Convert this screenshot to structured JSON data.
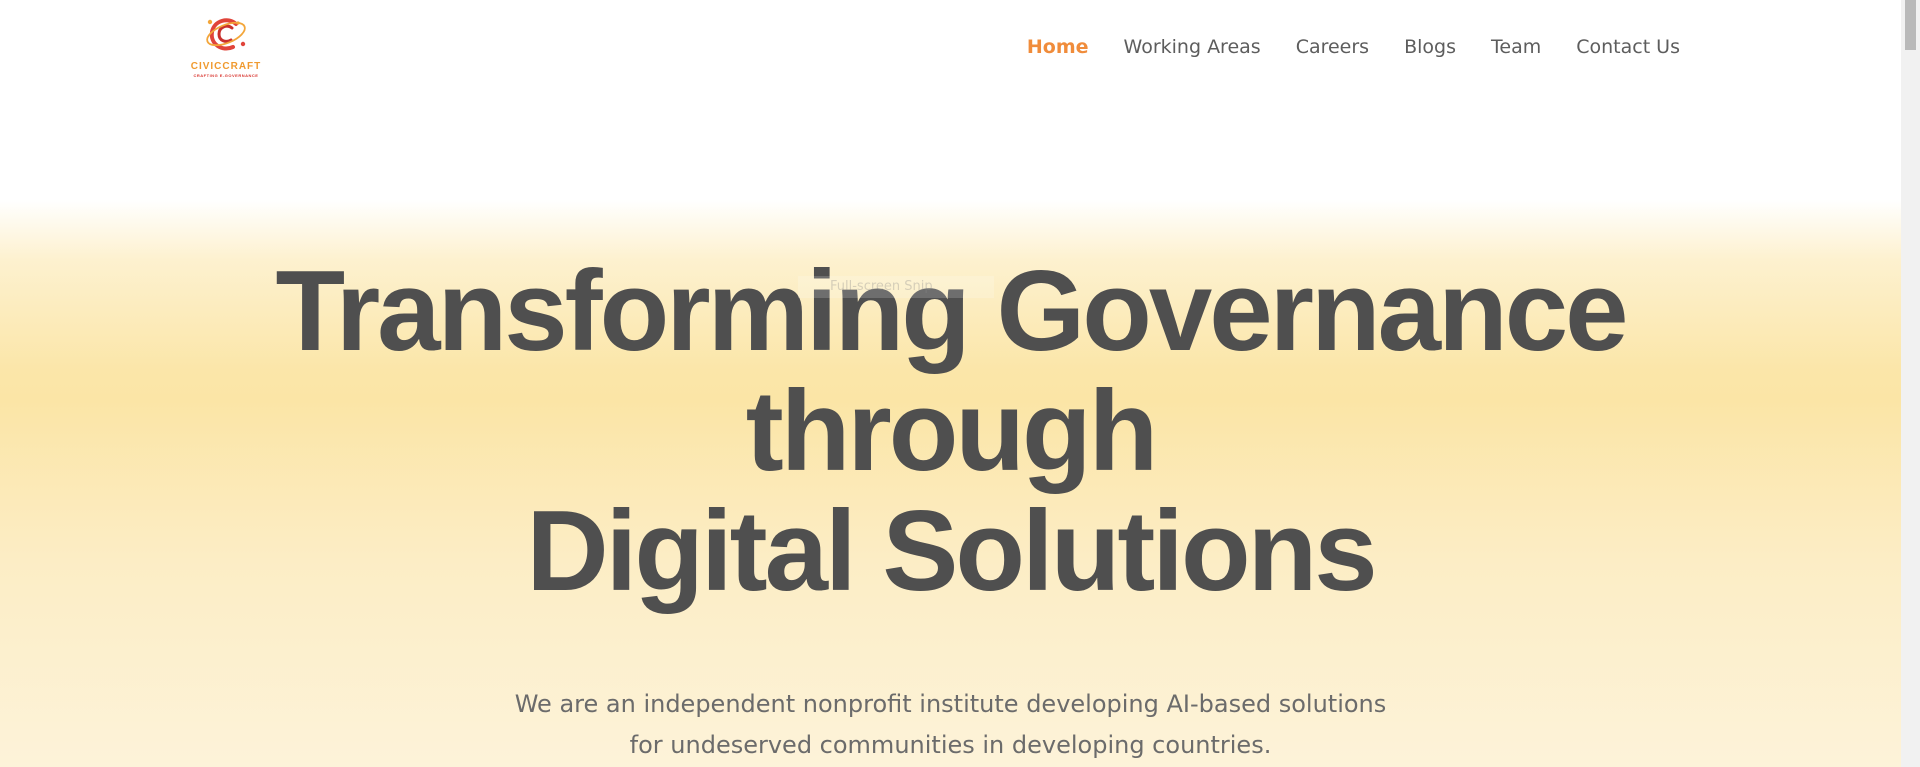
{
  "brand": {
    "name": "CIVICCRAFT",
    "tagline": "CRAFTING E-GOVERNANCE",
    "colors": {
      "primary": "#f09a2f",
      "secondary": "#d9352f"
    }
  },
  "nav": {
    "items": [
      {
        "label": "Home",
        "active": true
      },
      {
        "label": "Working Areas",
        "active": false
      },
      {
        "label": "Careers",
        "active": false
      },
      {
        "label": "Blogs",
        "active": false
      },
      {
        "label": "Team",
        "active": false
      },
      {
        "label": "Contact Us",
        "active": false
      }
    ],
    "active_color": "#f08c3b"
  },
  "hero": {
    "title_lines": [
      "Transforming Governance",
      "through",
      "Digital Solutions"
    ],
    "subtitle_lines": [
      "We are an independent nonprofit institute developing AI-based solutions",
      "for undeserved communities in developing countries."
    ]
  },
  "overlay": {
    "snip_label": "Full-screen Snip"
  }
}
